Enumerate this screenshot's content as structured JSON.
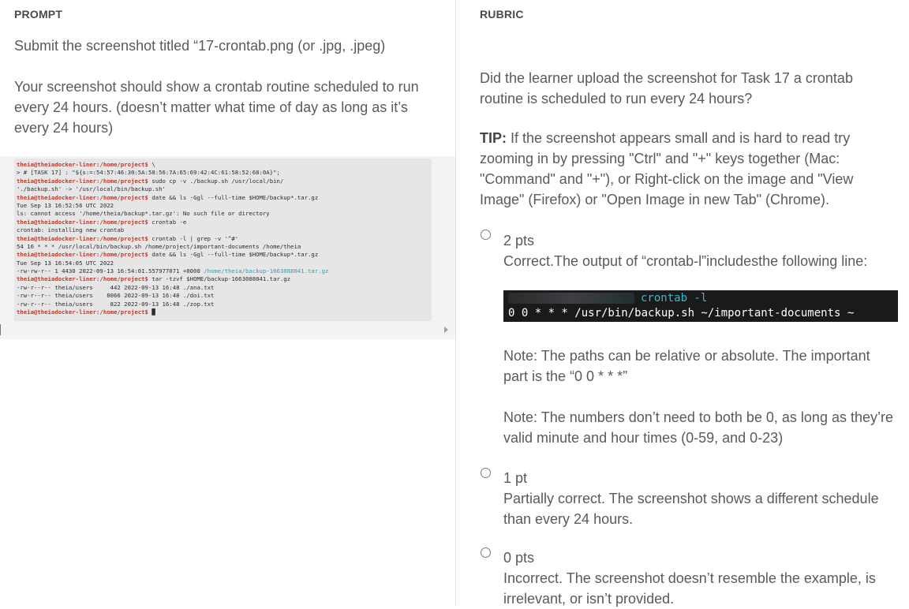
{
  "prompt": {
    "heading": "PROMPT",
    "submit_text": "Submit the screenshot titled “17-crontab.png (or .jpg, .jpeg)",
    "description": "Your screenshot should show a crontab routine scheduled to run every 24 hours. (doesn’t matter what time of day as long as it’s every 24 hours)",
    "terminal_lines": [
      {
        "prompt": "theia@theiadocker-liner:/home/project$",
        "text": " \\"
      },
      {
        "prompt": "",
        "text": "> # [TASK 17] : \"${s:=:54:57:46:30:5A:58:56:7A:65:69:42:4C:61:58:52:68:0A}\";"
      },
      {
        "prompt": "theia@theiadocker-liner:/home/project$",
        "text": " sudo cp -v ./backup.sh /usr/local/bin/"
      },
      {
        "prompt": "",
        "text": "'./backup.sh' -> '/usr/local/bin/backup.sh'"
      },
      {
        "prompt": "theia@theiadocker-liner:/home/project$",
        "text": " date && ls -Ggl --full-time $HOME/backup*.tar.gz"
      },
      {
        "prompt": "",
        "text": "Tue Sep 13 16:52:56 UTC 2022"
      },
      {
        "prompt": "",
        "text": "ls: cannot access '/home/theia/backup*.tar.gz': No such file or directory"
      },
      {
        "prompt": "theia@theiadocker-liner:/home/project$",
        "text": " crontab -e"
      },
      {
        "prompt": "",
        "text": "crontab: installing new crontab"
      },
      {
        "prompt": "theia@theiadocker-liner:/home/project$",
        "text": " crontab -l | grep -v '^#'"
      },
      {
        "prompt": "",
        "text": "54 16 * * * /usr/local/bin/backup.sh /home/project/important-documents /home/theia"
      },
      {
        "prompt": "theia@theiadocker-liner:/home/project$",
        "text": " date && ls -Ggl --full-time $HOME/backup*.tar.gz"
      },
      {
        "prompt": "",
        "text": "Tue Sep 13 16:54:05 UTC 2022"
      },
      {
        "prompt": "",
        "text": "-rw-rw-r-- 1 4430 2022-09-13 16:54:01.557977071 +0000 ",
        "highlight": "/home/theia/backup-1663088041.tar.gz"
      },
      {
        "prompt": "theia@theiadocker-liner:/home/project$",
        "text": " tar -tzvf $HOME/backup-1663088041.tar.gz"
      },
      {
        "prompt": "",
        "text": "-rw-r--r-- theia/users     442 2022-09-13 16:48 ./ana.txt"
      },
      {
        "prompt": "",
        "text": "-rw-r--r-- theia/users    8066 2022-09-13 16:48 ./doi.txt"
      },
      {
        "prompt": "",
        "text": "-rw-r--r-- theia/users     822 2022-09-13 16:48 ./zop.txt"
      },
      {
        "prompt": "theia@theiadocker-liner:/home/project$",
        "text": " █"
      }
    ]
  },
  "rubric": {
    "heading": "RUBRIC",
    "question": "Did the learner upload the screenshot for Task 17 a crontab routine is scheduled to run every 24 hours?",
    "tip_label": "TIP:",
    "tip_text": " If the screenshot appears small and is hard to read try zooming in by pressing \"Ctrl\" and \"+\" keys together (Mac: \"Command\" and \"+\"), or Right-click on the image and \"View Image\" (Firefox) or \"Open Image in new Tab\" (Chrome).",
    "options": [
      {
        "points": "2 pts",
        "description": "Correct.The output of “crontab-l”includesthe following line:"
      },
      {
        "points": "1 pt",
        "description": "Partially correct. The screenshot shows a different schedule than every 24 hours."
      },
      {
        "points": "0 pts",
        "description": "Incorrect. The screenshot doesn’t resemble the example, is irrelevant, or isn’t provided."
      }
    ],
    "example_command": "crontab -l",
    "example_entry": "0 0 * * * /usr/bin/backup.sh ~/important-documents ~",
    "note1": "Note: The paths can be relative or absolute. The important part is the “0 0 * * *”",
    "note2": "Note: The numbers don’t need to both be 0, as long as they’re valid minute and hour times (0-59, and 0-23)"
  }
}
